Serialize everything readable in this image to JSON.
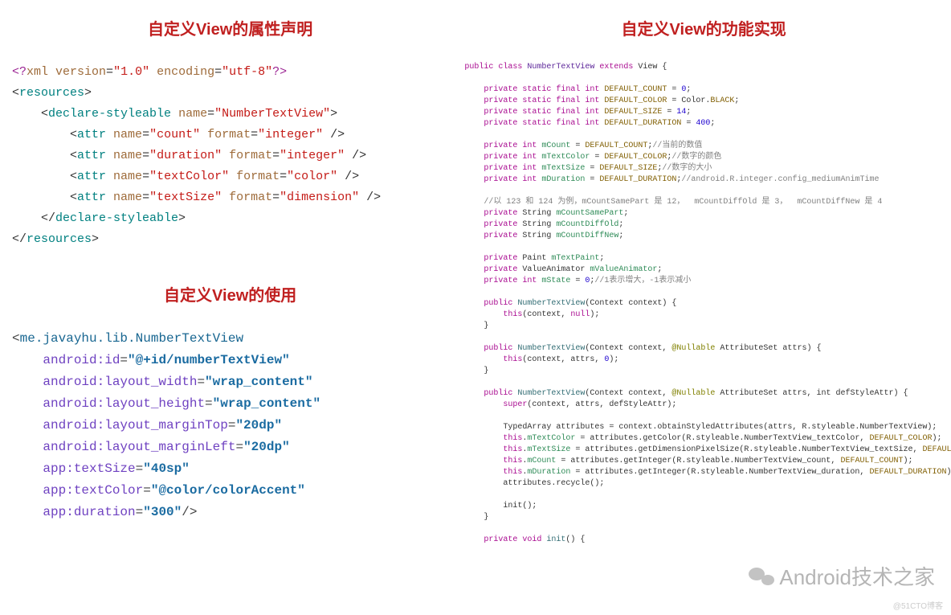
{
  "titles": {
    "declare": "自定义View的属性声明",
    "usage": "自定义View的使用",
    "impl": "自定义View的功能实现"
  },
  "xml": {
    "header": "<?xml version=\"1.0\" encoding=\"utf-8\"?>",
    "resources_open": "resources",
    "styleable_open_attr": "declare-styleable",
    "styleable_name_attr": "name",
    "styleable_name_val": "NumberTextView",
    "attrs": [
      {
        "name": "count",
        "format": "integer"
      },
      {
        "name": "duration",
        "format": "integer"
      },
      {
        "name": "textColor",
        "format": "color"
      },
      {
        "name": "textSize",
        "format": "dimension"
      }
    ],
    "attr_tag": "attr",
    "name_label": "name",
    "format_label": "format",
    "styleable_close": "declare-styleable",
    "resources_close": "resources"
  },
  "usage": {
    "tag": "me.javayhu.lib.NumberTextView",
    "attrs": [
      {
        "k": "android:id",
        "v": "@+id/numberTextView"
      },
      {
        "k": "android:layout_width",
        "v": "wrap_content"
      },
      {
        "k": "android:layout_height",
        "v": "wrap_content"
      },
      {
        "k": "android:layout_marginTop",
        "v": "20dp"
      },
      {
        "k": "android:layout_marginLeft",
        "v": "20dp"
      },
      {
        "k": "app:textSize",
        "v": "40sp"
      },
      {
        "k": "app:textColor",
        "v": "@color/colorAccent"
      },
      {
        "k": "app:duration",
        "v": "300"
      }
    ]
  },
  "java": {
    "class_decl": {
      "public": "public class",
      "name": "NumberTextView",
      "extends": "extends",
      "super": "View"
    },
    "consts": [
      {
        "mod": "private static final int",
        "name": "DEFAULT_COUNT",
        "val": "0"
      },
      {
        "mod": "private static final int",
        "name": "DEFAULT_COLOR",
        "val": "Color.BLACK"
      },
      {
        "mod": "private static final int",
        "name": "DEFAULT_SIZE",
        "val": "14"
      },
      {
        "mod": "private static final int",
        "name": "DEFAULT_DURATION",
        "val": "400"
      }
    ],
    "fields1": [
      {
        "mod": "private int",
        "name": "mCount",
        "init": "DEFAULT_COUNT",
        "comment": "//当前的数值"
      },
      {
        "mod": "private int",
        "name": "mTextColor",
        "init": "DEFAULT_COLOR",
        "comment": "//数字的颜色"
      },
      {
        "mod": "private int",
        "name": "mTextSize",
        "init": "DEFAULT_SIZE",
        "comment": "//数字的大小"
      },
      {
        "mod": "private int",
        "name": "mDuration",
        "init": "DEFAULT_DURATION",
        "comment": "//android.R.integer.config_mediumAnimTime"
      }
    ],
    "comment1": "//以 123 和 124 为例，mCountSamePart 是 12，  mCountDiffOld 是 3，  mCountDiffNew 是 4",
    "strings": [
      "mCountSamePart",
      "mCountDiffOld",
      "mCountDiffNew"
    ],
    "string_mod": "private",
    "string_type": "String",
    "paint_line": {
      "mod": "private",
      "type": "Paint",
      "name": "mTextPaint"
    },
    "anim_line": {
      "mod": "private",
      "type": "ValueAnimator",
      "name": "mValueAnimator"
    },
    "state_line": {
      "mod": "private int",
      "name": "mState",
      "val": "0",
      "comment": "//1表示增大，-1表示减小"
    },
    "ctor1": {
      "sig": "public",
      "name": "NumberTextView",
      "params": "(Context context) {",
      "body": "this(context, null);"
    },
    "ctor2": {
      "sig": "public",
      "name": "NumberTextView",
      "params_pre": "(Context context, ",
      "anno": "@Nullable",
      "params_post": " AttributeSet attrs) {",
      "body": "this(context, attrs, 0);"
    },
    "ctor3": {
      "sig": "public",
      "name": "NumberTextView",
      "params_pre": "(Context context, ",
      "anno": "@Nullable",
      "params_post": " AttributeSet attrs, int defStyleAttr) {"
    },
    "ctor3_body": [
      "super(context, attrs, defStyleAttr);",
      "",
      "TypedArray attributes = context.obtainStyledAttributes(attrs, R.styleable.NumberTextView);",
      "this.mTextColor = attributes.getColor(R.styleable.NumberTextView_textColor, DEFAULT_COLOR);",
      "this.mTextSize = attributes.getDimensionPixelSize(R.styleable.NumberTextView_textSize, DEFAULT_SIZE);",
      "this.mCount = attributes.getInteger(R.styleable.NumberTextView_count, DEFAULT_COUNT);",
      "this.mDuration = attributes.getInteger(R.styleable.NumberTextView_duration, DEFAULT_DURATION);",
      "attributes.recycle();",
      "",
      "init();"
    ],
    "init_sig": "private void init() {"
  },
  "watermark": "Android技术之家",
  "blog_watermark": "@51CTO博客"
}
